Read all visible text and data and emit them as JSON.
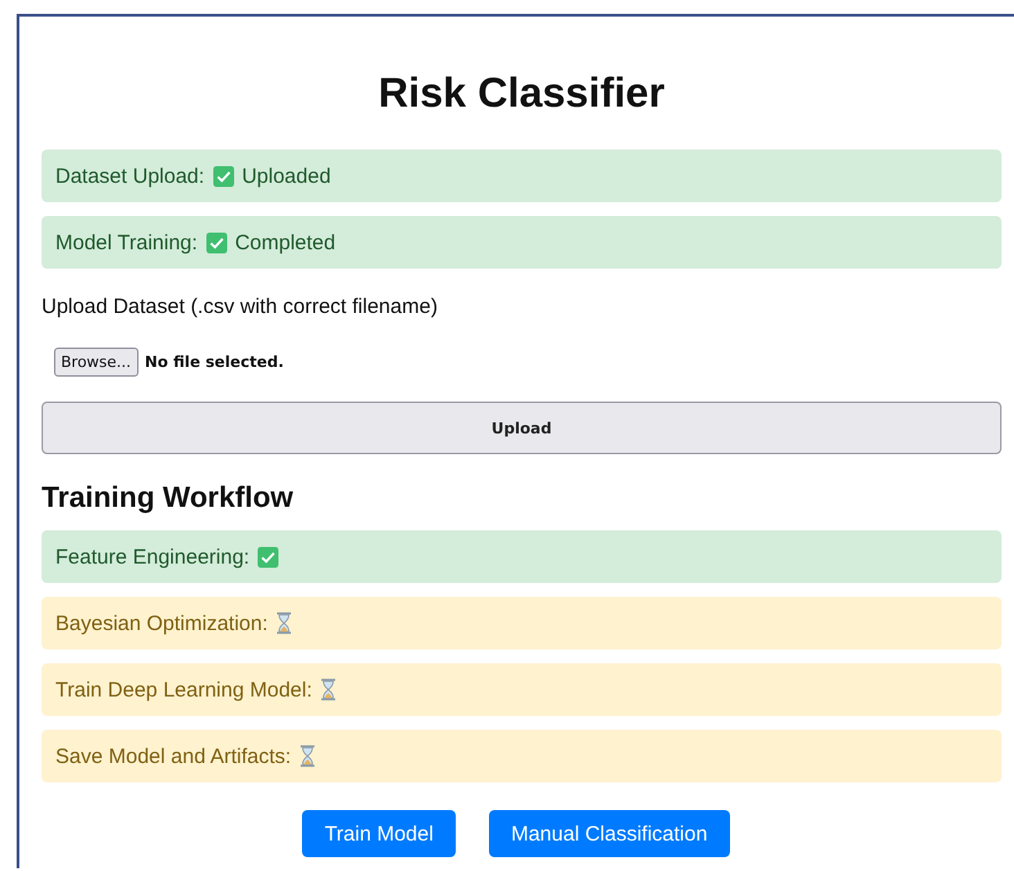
{
  "title": "Risk Classifier",
  "statuses": [
    {
      "label": "Dataset Upload:",
      "done": true,
      "value": "Uploaded"
    },
    {
      "label": "Model Training:",
      "done": true,
      "value": "Completed"
    }
  ],
  "upload": {
    "label": "Upload Dataset (.csv with correct filename)",
    "browse": "Browse...",
    "file_status": "No file selected.",
    "button": "Upload"
  },
  "workflow": {
    "heading": "Training Workflow",
    "steps": [
      {
        "label": "Feature Engineering:",
        "done": true
      },
      {
        "label": "Bayesian Optimization:",
        "done": false
      },
      {
        "label": "Train Deep Learning Model:",
        "done": false
      },
      {
        "label": "Save Model and Artifacts:",
        "done": false
      }
    ]
  },
  "buttons": [
    "Train Model",
    "Manual Classification"
  ]
}
